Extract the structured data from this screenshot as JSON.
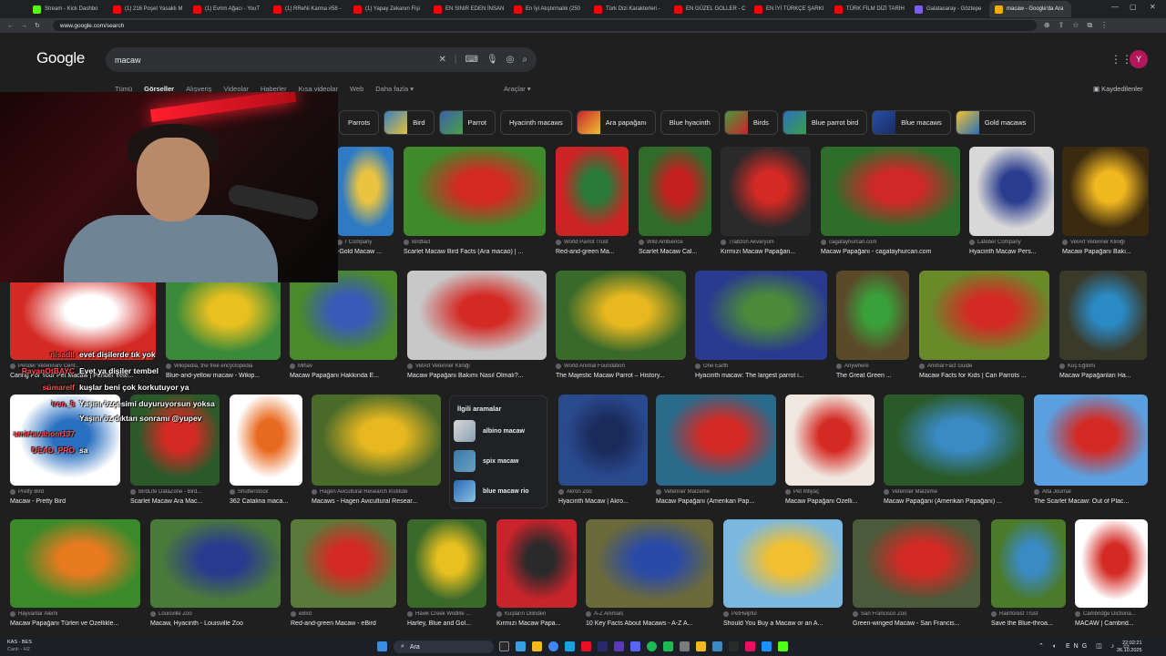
{
  "browser": {
    "tabs": [
      {
        "label": "Stream - Kick Dashbo",
        "color": "#53fc18"
      },
      {
        "label": "(1) 216 Poşet Yasaklı M",
        "color": "#ff0000"
      },
      {
        "label": "(1) Evrim Ağacı - YouT",
        "color": "#ff0000"
      },
      {
        "label": "(1) RReNi Karma #58 -",
        "color": "#ff0000"
      },
      {
        "label": "(1) Yapay Zekanın Fişi",
        "color": "#ff0000"
      },
      {
        "label": "EN SINIR EDEN İNSAN",
        "color": "#ff0000"
      },
      {
        "label": "En İyi Atıştırmalık (250",
        "color": "#ff0000"
      },
      {
        "label": "Türk Dizi Karakterleri -",
        "color": "#ff0000"
      },
      {
        "label": "EN GÜZEL GOLLER - C",
        "color": "#ff0000"
      },
      {
        "label": "EN İYİ TÜRKÇE ŞARKI",
        "color": "#ff0000"
      },
      {
        "label": "TÜRK FİLM DİZİ TARİH",
        "color": "#ff0000"
      },
      {
        "label": "Galatasaray - Göztepe",
        "color": "#7b5cf5"
      },
      {
        "label": "macaw - Google'da Ara",
        "color": "#f9ab00",
        "active": true
      }
    ],
    "url": "www.google.com/search"
  },
  "search": {
    "logo": "Google",
    "query": "macaw",
    "avatar_letter": "Y",
    "tabs": [
      "Tümü",
      "Görseller",
      "Alışveriş",
      "Videolar",
      "Haberler",
      "Kısa videolar",
      "Web",
      "Daha fazla ▾"
    ],
    "tools": "Araçlar ▾",
    "saved": "Kaydedilenler"
  },
  "chips": [
    {
      "label": "Parrots",
      "thumb": false
    },
    {
      "label": "Bird",
      "thumb": true,
      "c1": "#3b7fc4",
      "c2": "#e2c13a"
    },
    {
      "label": "Parrot",
      "thumb": true,
      "c1": "#3b5fa8",
      "c2": "#4aa04a"
    },
    {
      "label": "Hyacinth macaws",
      "thumb": false
    },
    {
      "label": "Ara papağanı",
      "thumb": true,
      "c1": "#c8242b",
      "c2": "#f0c030"
    },
    {
      "label": "Blue hyacinth",
      "thumb": false
    },
    {
      "label": "Birds",
      "thumb": true,
      "c1": "#4a9a3a",
      "c2": "#c8242b"
    },
    {
      "label": "Blue parrot bird",
      "thumb": true,
      "c1": "#2d6fbf",
      "c2": "#3aa04a"
    },
    {
      "label": "Blue macaws",
      "thumb": true,
      "c1": "#2850a8",
      "c2": "#1a2a60"
    },
    {
      "label": "Gold macaws",
      "thumb": true,
      "c1": "#f2c230",
      "c2": "#2a6fb8"
    }
  ],
  "results": {
    "row1": [
      {
        "src": "r Company",
        "title": "-Gold Macaw ...",
        "c1": "#2e7bc4",
        "c2": "#e9c341"
      },
      {
        "src": "Birdfact",
        "title": "Scarlet Macaw Bird Facts (Ara macao) | ...",
        "c1": "#3f8a2a",
        "c2": "#d32a22"
      },
      {
        "src": "World Parrot Trust",
        "title": "Red-and-green Ma...",
        "c1": "#cc2424",
        "c2": "#2a7a3a"
      },
      {
        "src": "Wild Ambience",
        "title": "Scarlet Macaw Cal...",
        "c1": "#2f6b2a",
        "c2": "#c42020"
      },
      {
        "src": "Trabzon Akvaryum",
        "title": "Kırmızı Macaw Papağan...",
        "c1": "#2a2a2a",
        "c2": "#d42a24"
      },
      {
        "src": "cagatayhurcan.com",
        "title": "Macaw Papağanı - cagatayhurcan.com",
        "c1": "#2d6e2a",
        "c2": "#d02828"
      },
      {
        "src": "Lafeber Company",
        "title": "Hyacinth Macaw Pers...",
        "c1": "#d8d8d8",
        "c2": "#2a3c8e"
      },
      {
        "src": "VetArt Veteriner Kliniği",
        "title": "Macaw Papağanı Bakı...",
        "c1": "#3a2a10",
        "c2": "#f2b820"
      }
    ],
    "row2": [
      {
        "src": "Pender Veterinary Cent...",
        "title": "Caring For Your Pet Macaw | Pender Vete...",
        "c1": "#d42a24",
        "c2": "#ffffff"
      },
      {
        "src": "Wikipedia, the free encyclopedia",
        "title": "Blue-and-yellow macaw - Wikip...",
        "c1": "#3a8a3a",
        "c2": "#e8c020"
      },
      {
        "src": "Mihav",
        "title": "Macaw Papağanı Hakkında E...",
        "c1": "#4a8a2a",
        "c2": "#3a5ab8"
      },
      {
        "src": "VetArt Veteriner Kliniği",
        "title": "Macaw Papağanı Bakımı Nasıl Olmalı?...",
        "c1": "#c8c8c8",
        "c2": "#d42a24"
      },
      {
        "src": "World Animal Foundation",
        "title": "The Majestic Macaw Parrot – History...",
        "c1": "#3a6a2a",
        "c2": "#e8b820"
      },
      {
        "src": "One Earth",
        "title": "Hyacinth macaw: The largest parrot i...",
        "c1": "#2a3a8e",
        "c2": "#4a8a3a"
      },
      {
        "src": "Anywhere",
        "title": "The Great Green ...",
        "c1": "#5a4a2a",
        "c2": "#3aa03a"
      },
      {
        "src": "Animal Fact Guide",
        "title": "Macaw Facts for Kids | Can Parrots ...",
        "c1": "#6a8a2a",
        "c2": "#d42a24"
      },
      {
        "src": "Kuş Eğitimi",
        "title": "Macaw Papağanları Ha...",
        "c1": "#3a3a2a",
        "c2": "#2a8ac4"
      }
    ],
    "row3": [
      {
        "src": "Pretty Bird",
        "title": "Macaw - Pretty Bird",
        "c1": "#ffffff",
        "c2": "#2a70c0"
      },
      {
        "src": "BirdLife DataZone - Bird...",
        "title": "Scarlet Macaw Ara Mac...",
        "c1": "#2a5a2a",
        "c2": "#d42a24"
      },
      {
        "src": "Shutterstock",
        "title": "362 Catalina maca...",
        "c1": "#ffffff",
        "c2": "#e86a20"
      },
      {
        "src": "Hagen Avicultural Research Institute",
        "title": "Macaws - Hagen Avicultural Resear...",
        "c1": "#4a6a2a",
        "c2": "#e8b820"
      },
      {
        "src": "Akron Zoo",
        "title": "Hyacinth Macaw | Akro...",
        "c1": "#2a4a8e",
        "c2": "#1a2a5a"
      },
      {
        "src": "Veteriner Malzeme",
        "title": "Macaw Papağanı (Amerikan Pap...",
        "c1": "#2a6a8a",
        "c2": "#d42a24"
      },
      {
        "src": "Pet İhtiyaç",
        "title": "Macaw Papağanı Özelli...",
        "c1": "#f0e8e0",
        "c2": "#d42a24"
      },
      {
        "src": "Veteriner Malzeme",
        "title": "Macaw Papağanı (Amerikan Papağanı) ...",
        "c1": "#2a5a2a",
        "c2": "#3a8ac4"
      },
      {
        "src": "Alta Journal",
        "title": "The Scarlet Macaw: Out of Plac...",
        "c1": "#5aa0e0",
        "c2": "#d42a24"
      }
    ],
    "row4": [
      {
        "src": "Hayvanlar Alemi",
        "title": "Macaw Papağanı Türleri ve Özellikle...",
        "c1": "#3a8a2a",
        "c2": "#e87a20"
      },
      {
        "src": "Louisville Zoo",
        "title": "Macaw, Hyacinth - Louisville Zoo",
        "c1": "#4a7a3a",
        "c2": "#2a3a8e"
      },
      {
        "src": "eBird",
        "title": "Red-and-green Macaw - eBird",
        "c1": "#5a7a3a",
        "c2": "#d42a24"
      },
      {
        "src": "Hawk Creek Wildlife ...",
        "title": "Harley, Blue and Gol...",
        "c1": "#3a6a2a",
        "c2": "#e8c020"
      },
      {
        "src": "Kuşların Dilinden",
        "title": "Kırmızı Macaw Papa...",
        "c1": "#c8242b",
        "c2": "#2a2a2a"
      },
      {
        "src": "A-Z Animals",
        "title": "10 Key Facts About Macaws - A-Z A...",
        "c1": "#6a6a3a",
        "c2": "#2a4aa8"
      },
      {
        "src": "PetHelpful",
        "title": "Should You Buy a Macaw or an A...",
        "c1": "#7ab8e0",
        "c2": "#f2c030"
      },
      {
        "src": "San Francisco Zoo",
        "title": "Green-winged Macaw - San Francis...",
        "c1": "#4a5a3a",
        "c2": "#d42a24"
      },
      {
        "src": "Rainforest Trust",
        "title": "Save the Blue-throa...",
        "c1": "#4a7a2a",
        "c2": "#3a8ac4"
      },
      {
        "src": "Cambridge Dictiona...",
        "title": "MACAW | Cambrid...",
        "c1": "#ffffff",
        "c2": "#d42a24"
      }
    ]
  },
  "related": {
    "heading": "İlgili aramalar",
    "items": [
      {
        "label": "albino macaw",
        "c1": "#d8d8d8",
        "c2": "#8aa0b0"
      },
      {
        "label": "spix macaw",
        "c1": "#3a7aa8",
        "c2": "#6aa0c0"
      },
      {
        "label": "blue macaw rio",
        "c1": "#2a6ab8",
        "c2": "#8ac0e0"
      }
    ]
  },
  "chat": [
    {
      "user": "nisadll",
      "msg": "evet dişilerde tık yok"
    },
    {
      "user": "RayanOtBAYC",
      "msg": "Evet ya dişiler tembel"
    },
    {
      "user": "sümarelf",
      "msg": "kuşlar beni çok korkutuyor ya"
    },
    {
      "user": "iron_8",
      "msg": "Yapay Zekanın Fişi'ni Çekmek Mümkün mü?",
      "note": "Yaşını özçesimi duyuruyorsun yoksa"
    },
    {
      "user": "",
      "msg": "Yaşını öz dıktan sonramı @yupev"
    },
    {
      "user": "amirtavahom137",
      "msg": ""
    },
    {
      "user": "DEAD_PRO",
      "msg": "sa"
    }
  ],
  "taskbar": {
    "weather_line1": "KAS - BES",
    "weather_line2": "Canlı - H2",
    "search": "Ara",
    "time": "22:02:21",
    "date": "26.10.2025"
  }
}
